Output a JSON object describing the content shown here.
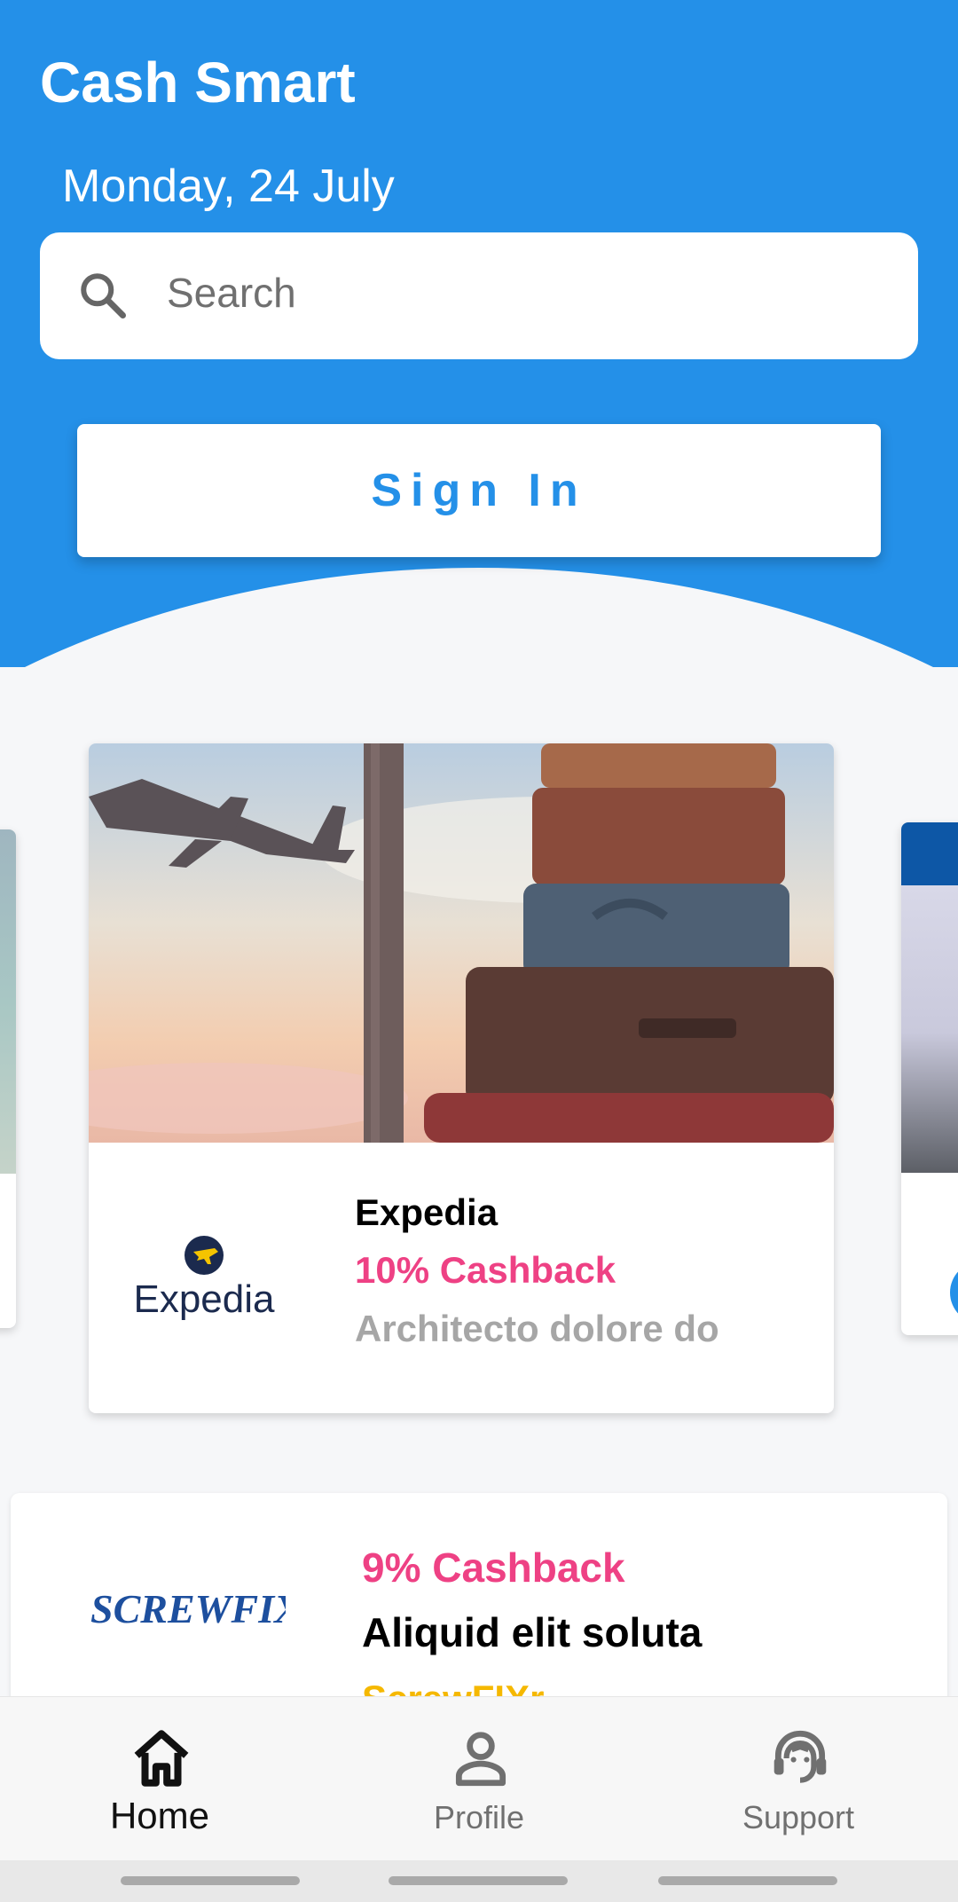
{
  "header": {
    "app_title": "Cash Smart",
    "date": "Monday, 24 July",
    "brand_color": "#2490e8"
  },
  "search": {
    "placeholder": "Search",
    "value": "",
    "icon": "search-icon"
  },
  "signin": {
    "label": "Sign In"
  },
  "carousel": {
    "featured": {
      "merchant": "Expedia",
      "logo_text": "Expedia",
      "cashback": "10% Cashback",
      "description": "Architecto dolore do",
      "image": "airplane-and-luggage"
    }
  },
  "list": [
    {
      "logo_text": "SCREWFIX",
      "cashback": "9% Cashback",
      "description": "Aliquid elit soluta",
      "brand": "ScrewFIXr"
    }
  ],
  "nav": {
    "items": [
      {
        "label": "Home",
        "icon": "home-icon",
        "active": true
      },
      {
        "label": "Profile",
        "icon": "person-icon",
        "active": false
      },
      {
        "label": "Support",
        "icon": "support-agent-icon",
        "active": false
      }
    ]
  },
  "colors": {
    "cashback": "#ee4184",
    "muted": "#a6a6a6",
    "brand_yellow": "#f5b800"
  }
}
